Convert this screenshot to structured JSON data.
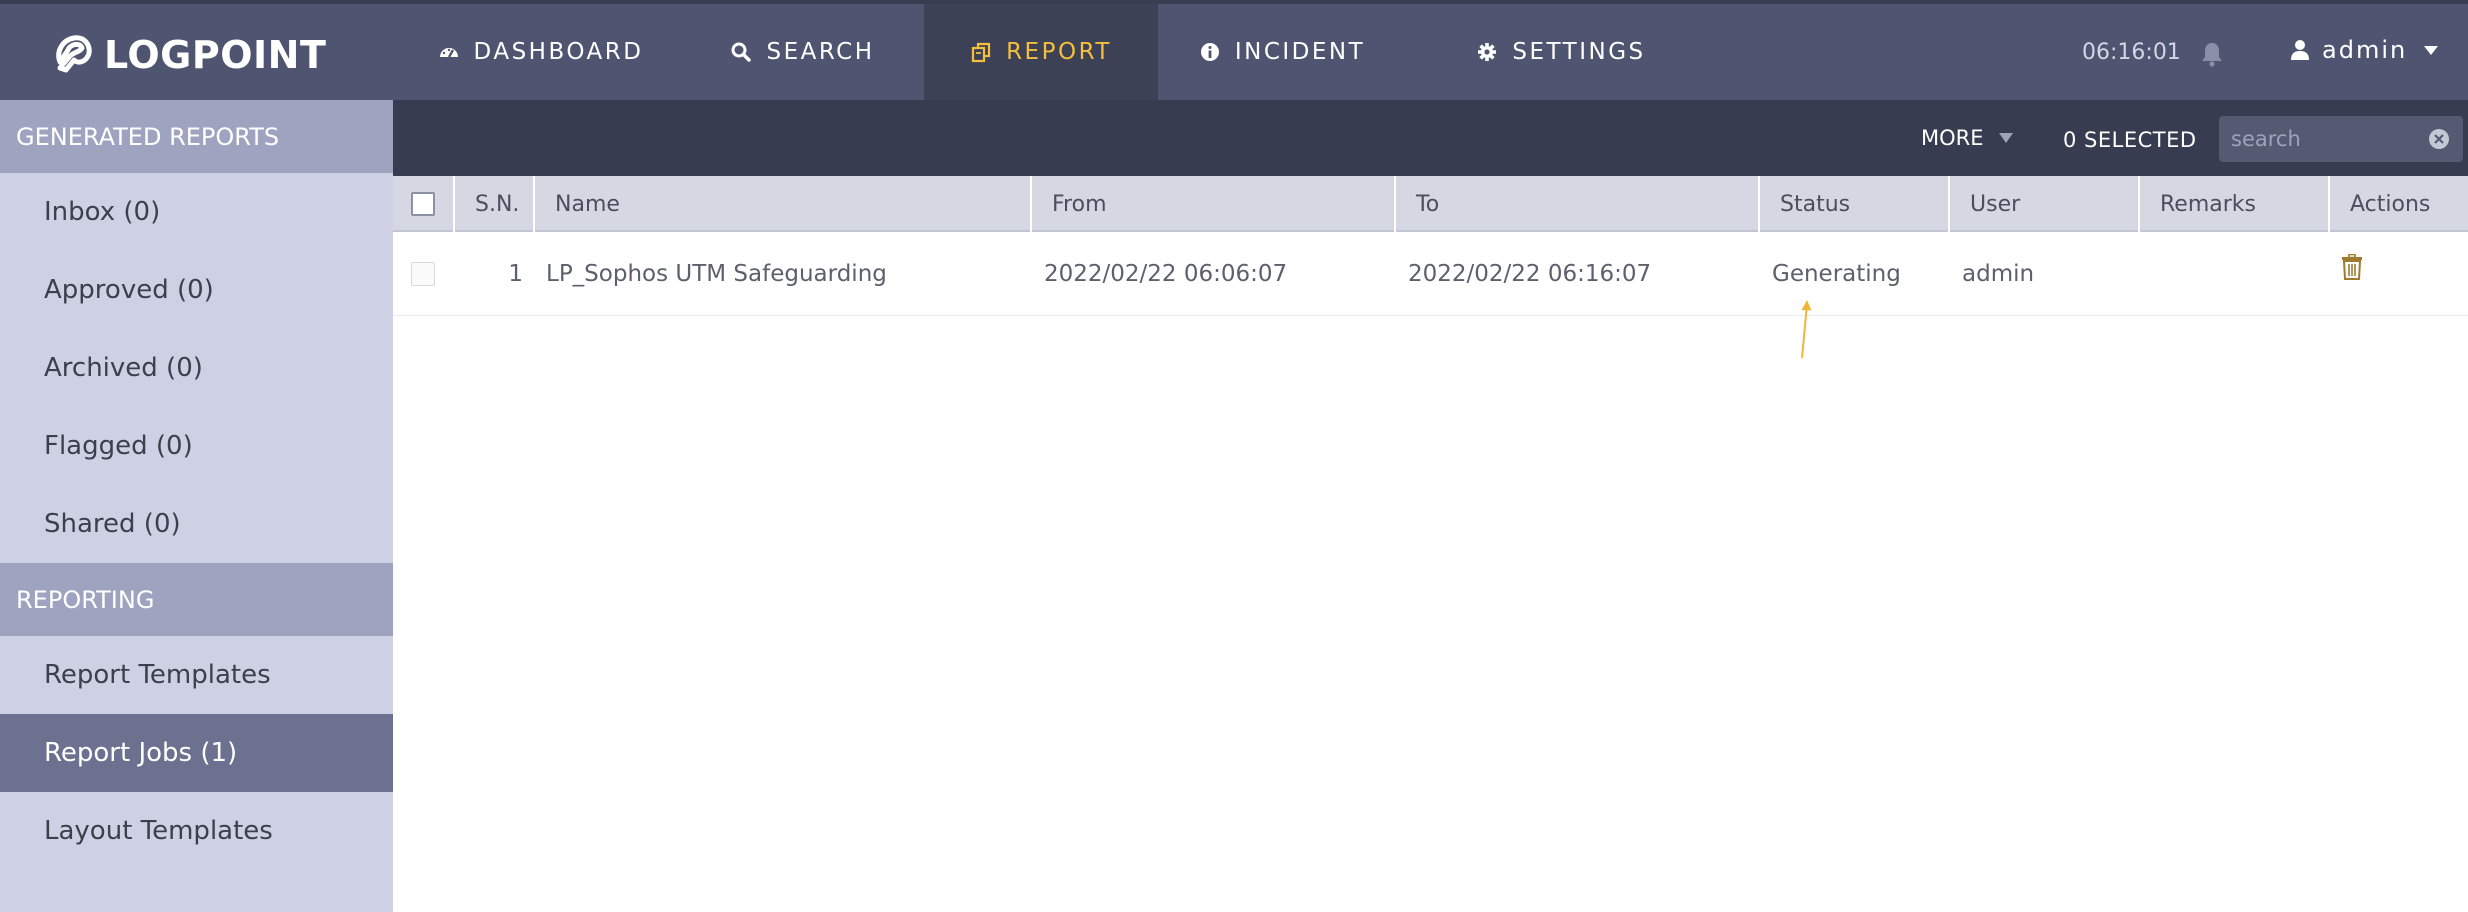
{
  "header": {
    "logo_text": "LOGPOINT",
    "nav": [
      {
        "label": "DASHBOARD",
        "icon": "dashboard-icon"
      },
      {
        "label": "SEARCH",
        "icon": "search-icon"
      },
      {
        "label": "REPORT",
        "icon": "report-icon",
        "active": true
      },
      {
        "label": "INCIDENT",
        "icon": "info-icon"
      },
      {
        "label": "SETTINGS",
        "icon": "gear-icon"
      }
    ],
    "time": "06:16:01",
    "user": "admin"
  },
  "sidebar": {
    "sections": [
      {
        "title": "GENERATED REPORTS",
        "items": [
          "Inbox (0)",
          "Approved (0)",
          "Archived (0)",
          "Flagged (0)",
          "Shared (0)"
        ]
      },
      {
        "title": "REPORTING",
        "items": [
          "Report Templates",
          "Report Jobs (1)",
          "Layout Templates"
        ]
      }
    ],
    "active_item": "Report Jobs (1)"
  },
  "toolbar": {
    "more_label": "MORE",
    "selected_label": "0 SELECTED",
    "search_placeholder": "search"
  },
  "table": {
    "columns": [
      "S.N.",
      "Name",
      "From",
      "To",
      "Status",
      "User",
      "Remarks",
      "Actions"
    ],
    "rows": [
      {
        "sn": "1",
        "name": "LP_Sophos UTM Safeguarding",
        "from": "2022/02/22 06:06:07",
        "to": "2022/02/22 06:16:07",
        "status": "Generating",
        "user": "admin",
        "remarks": ""
      }
    ]
  },
  "colors": {
    "topbar": "#4f5571",
    "accent": "#f3bf3d",
    "sidebar": "#cdd1e3",
    "sidebar_active": "#6c7190",
    "toolbar": "#373c50"
  }
}
